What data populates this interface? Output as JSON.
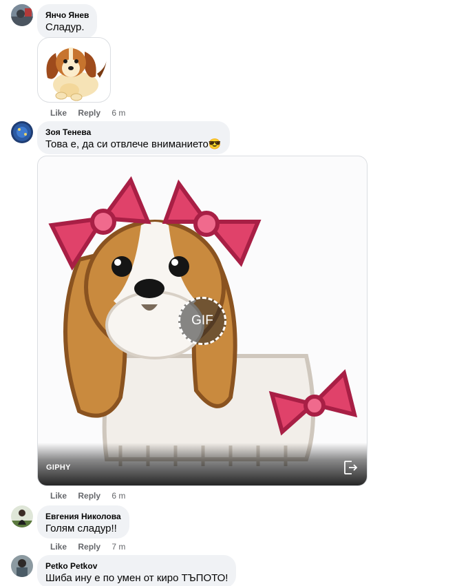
{
  "comments": [
    {
      "author": "Янчо Янев",
      "text": "Сладур.",
      "actions": {
        "like": "Like",
        "reply": "Reply",
        "time": "6 m"
      },
      "attachment": {
        "type": "sticker",
        "icon": "puppy-sticker-icon"
      }
    },
    {
      "author": "Зоя Тенева",
      "text": "Това е, да си отвлече вниманието😎",
      "actions": {
        "like": "Like",
        "reply": "Reply",
        "time": "6 m"
      },
      "attachment": {
        "type": "gif",
        "badge": "GIF",
        "source": "GIPHY",
        "icon": "open-external-icon"
      }
    },
    {
      "author": "Евгения Николова",
      "text": "Голям сладур!!",
      "actions": {
        "like": "Like",
        "reply": "Reply",
        "time": "7 m"
      }
    },
    {
      "author": "Petko Petkov",
      "text": "Шиба ину е по умен от киро ТЪПОТО!"
    }
  ],
  "colors": {
    "bubble": "#f0f2f5",
    "meta": "#65676b",
    "bow": "#e0426a",
    "fur": "#c98a3e"
  }
}
